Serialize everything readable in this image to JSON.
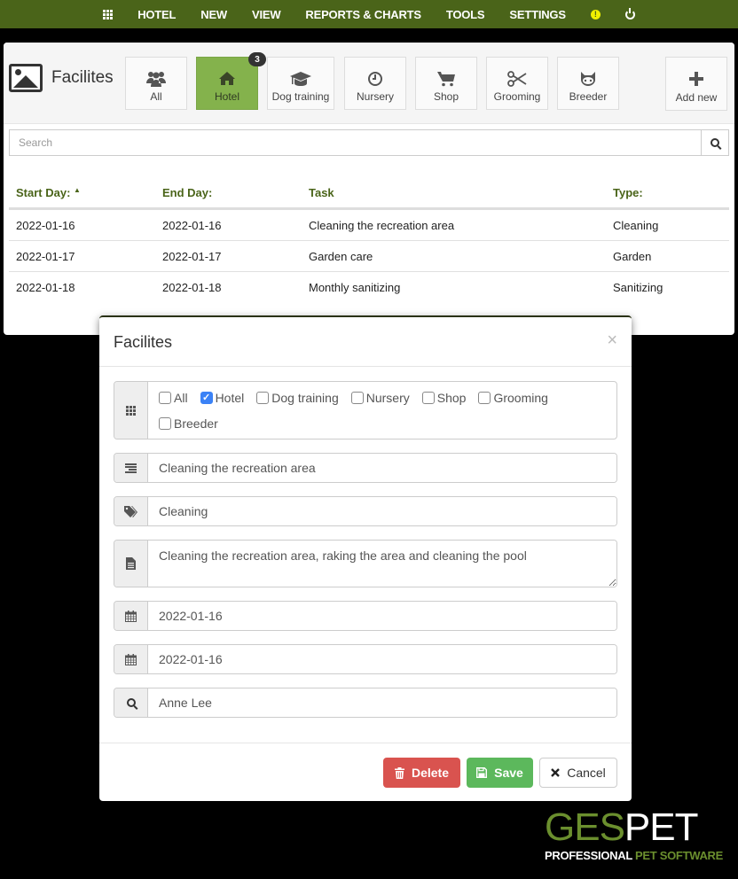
{
  "topnav": {
    "items": [
      "HOTEL",
      "NEW",
      "VIEW",
      "REPORTS & CHARTS",
      "TOOLS",
      "SETTINGS"
    ],
    "alert_symbol": "!"
  },
  "page": {
    "title": "Facilites",
    "categories": [
      {
        "label": "All",
        "icon": "users-icon",
        "glyph": "👥"
      },
      {
        "label": "Hotel",
        "icon": "home-icon",
        "glyph": "⌂",
        "active": true,
        "badge": "3"
      },
      {
        "label": "Dog training",
        "icon": "graduation-cap-icon",
        "glyph": "🎓"
      },
      {
        "label": "Nursery",
        "icon": "clock-icon",
        "glyph": "◷"
      },
      {
        "label": "Shop",
        "icon": "cart-icon",
        "glyph": "🛒"
      },
      {
        "label": "Grooming",
        "icon": "scissors-icon",
        "glyph": "✂"
      },
      {
        "label": "Breeder",
        "icon": "github-cat-icon",
        "glyph": "🐱"
      }
    ],
    "add_new_label": "Add new",
    "search_placeholder": "Search",
    "table": {
      "headers": [
        "Start Day:",
        "End Day:",
        "Task",
        "Type:"
      ],
      "sort_indicator": "▲",
      "rows": [
        [
          "2022-01-16",
          "2022-01-16",
          "Cleaning the recreation area",
          "Cleaning"
        ],
        [
          "2022-01-17",
          "2022-01-17",
          "Garden care",
          "Garden"
        ],
        [
          "2022-01-18",
          "2022-01-18",
          "Monthly sanitizing",
          "Sanitizing"
        ]
      ]
    }
  },
  "modal": {
    "title": "Facilites",
    "close": "×",
    "checkboxes": [
      {
        "label": "All",
        "checked": false
      },
      {
        "label": "Hotel",
        "checked": true
      },
      {
        "label": "Dog training",
        "checked": false
      },
      {
        "label": "Nursery",
        "checked": false
      },
      {
        "label": "Shop",
        "checked": false
      },
      {
        "label": "Grooming",
        "checked": false
      },
      {
        "label": "Breeder",
        "checked": false
      }
    ],
    "task": "Cleaning the recreation area",
    "type": "Cleaning",
    "description": "Cleaning the recreation area, raking the area and cleaning the pool",
    "start_date": "2022-01-16",
    "end_date": "2022-01-16",
    "person": "Anne Lee",
    "buttons": {
      "delete": "Delete",
      "save": "Save",
      "cancel": "Cancel"
    }
  },
  "logo": {
    "ges": "GES",
    "pet": "PET",
    "tagline_a": "PROFESSIONAL ",
    "tagline_b": "PET SOFTWARE"
  },
  "colors": {
    "nav_green": "#4a6419",
    "active_tab": "#84b24c",
    "delete": "#d9534f",
    "save": "#5cb85c",
    "checkbox": "#3b82f6"
  }
}
